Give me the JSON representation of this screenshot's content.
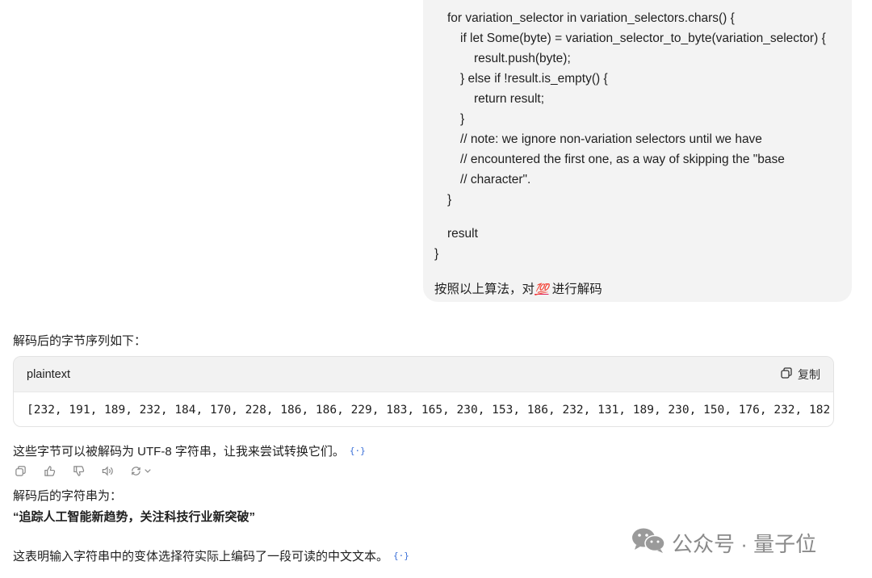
{
  "user_message": {
    "code_lines": [
      "for variation_selector in variation_selectors.chars() {",
      "if let Some(byte) = variation_selector_to_byte(variation_selector) {",
      "result.push(byte);",
      "} else if !result.is_empty() {",
      "return result;",
      "}",
      "// note: we ignore non-variation selectors until we have",
      "// encountered the first one, as a way of skipping the \"base",
      "// character\".",
      "}",
      "result",
      "}"
    ],
    "question_prefix": "按照以上算法，对",
    "question_emoji": "💯",
    "question_suffix": " 进行解码"
  },
  "response": {
    "intro": "解码后的字节序列如下：",
    "code_block": {
      "language": "plaintext",
      "copy_label": "复制",
      "content": "[232, 191, 189, 232, 184, 170, 228, 186, 186, 229, 183, 165, 230, 153, 186, 232, 131, 189, 230, 150, 176, 232, 182"
    },
    "explain": "这些字节可以被解码为 UTF-8 字符串，让我来尝试转换它们。",
    "ref_badge": "{·}",
    "result_label": "解码后的字符串为：",
    "result_value": "“追踪人工智能新趋势，关注科技行业新突破”",
    "conclusion": "这表明输入字符串中的变体选择符实际上编码了一段可读的中文文本。"
  },
  "watermark": {
    "text": "公众号 · 量子位"
  },
  "colors": {
    "bubble": "#f3f3f3",
    "link": "#3a6fd8",
    "watermark": "#8a8a8a"
  }
}
